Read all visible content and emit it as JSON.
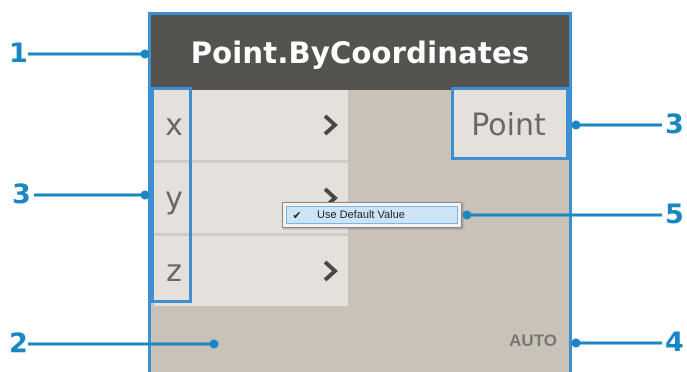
{
  "node": {
    "title": "Point.ByCoordinates",
    "inputs": [
      "x",
      "y",
      "z"
    ],
    "output": "Point",
    "lacing": "AUTO"
  },
  "context_menu": {
    "item_label": "Use Default Value",
    "checked": true
  },
  "callouts": {
    "c1": "1",
    "c2": "2",
    "c3_left": "3",
    "c3_right": "3",
    "c4": "4",
    "c5": "5"
  },
  "colors": {
    "accent": "#1a87c4",
    "highlight": "#3d8fd1",
    "header": "#555350",
    "body": "#c8c2b9",
    "port": "#e4e1dc"
  },
  "icons": {
    "port_arrow": "chevron-right-icon",
    "menu_check": "checkmark-icon"
  }
}
